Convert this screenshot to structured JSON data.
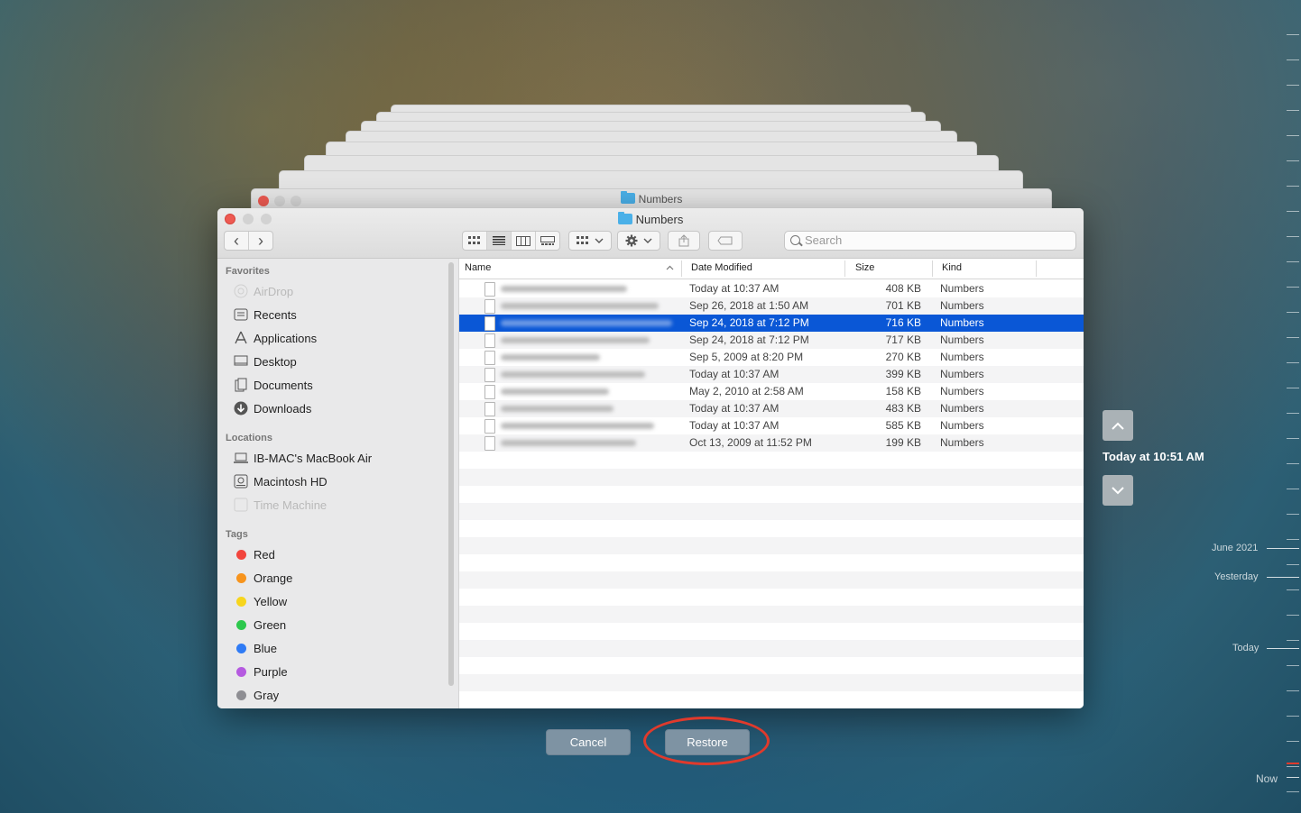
{
  "back_window": {
    "title": "Numbers"
  },
  "window": {
    "title": "Numbers"
  },
  "toolbar": {
    "back_glyph": "‹",
    "forward_glyph": "›",
    "view_icons": [
      "icon-view-icon",
      "list-view-icon",
      "column-view-icon",
      "gallery-view-icon"
    ],
    "search_placeholder": "Search"
  },
  "sidebar": {
    "favorites_header": "Favorites",
    "favorites": [
      {
        "label": "AirDrop",
        "icon": "airdrop-icon",
        "dim": true
      },
      {
        "label": "Recents",
        "icon": "recents-icon",
        "dim": false
      },
      {
        "label": "Applications",
        "icon": "applications-icon",
        "dim": false
      },
      {
        "label": "Desktop",
        "icon": "desktop-icon",
        "dim": false
      },
      {
        "label": "Documents",
        "icon": "documents-icon",
        "dim": false
      },
      {
        "label": "Downloads",
        "icon": "downloads-icon",
        "dim": false
      }
    ],
    "locations_header": "Locations",
    "locations": [
      {
        "label": "IB-MAC's MacBook Air",
        "icon": "laptop-icon",
        "dim": false
      },
      {
        "label": "Macintosh HD",
        "icon": "disk-icon",
        "dim": false
      },
      {
        "label": "Time Machine",
        "icon": "time-machine-icon",
        "dim": true
      }
    ],
    "tags_header": "Tags",
    "tags": [
      {
        "label": "Red",
        "color": "#f2453d"
      },
      {
        "label": "Orange",
        "color": "#f7941d"
      },
      {
        "label": "Yellow",
        "color": "#f7d51d"
      },
      {
        "label": "Green",
        "color": "#2dc84d"
      },
      {
        "label": "Blue",
        "color": "#2f7bf5"
      },
      {
        "label": "Purple",
        "color": "#b55ae0"
      },
      {
        "label": "Gray",
        "color": "#8e8e93"
      }
    ]
  },
  "columns": {
    "name": "Name",
    "date": "Date Modified",
    "size": "Size",
    "kind": "Kind"
  },
  "files": [
    {
      "date": "Today at 10:37 AM",
      "size": "408 KB",
      "kind": "Numbers",
      "selected": false
    },
    {
      "date": "Sep 26, 2018 at 1:50 AM",
      "size": "701 KB",
      "kind": "Numbers",
      "selected": false
    },
    {
      "date": "Sep 24, 2018 at 7:12 PM",
      "size": "716 KB",
      "kind": "Numbers",
      "selected": true
    },
    {
      "date": "Sep 24, 2018 at 7:12 PM",
      "size": "717 KB",
      "kind": "Numbers",
      "selected": false
    },
    {
      "date": "Sep 5, 2009 at 8:20 PM",
      "size": "270 KB",
      "kind": "Numbers",
      "selected": false
    },
    {
      "date": "Today at 10:37 AM",
      "size": "399 KB",
      "kind": "Numbers",
      "selected": false
    },
    {
      "date": "May 2, 2010 at 2:58 AM",
      "size": "158 KB",
      "kind": "Numbers",
      "selected": false
    },
    {
      "date": "Today at 10:37 AM",
      "size": "483 KB",
      "kind": "Numbers",
      "selected": false
    },
    {
      "date": "Today at 10:37 AM",
      "size": "585 KB",
      "kind": "Numbers",
      "selected": false
    },
    {
      "date": "Oct 13, 2009 at 11:52 PM",
      "size": "199 KB",
      "kind": "Numbers",
      "selected": false
    }
  ],
  "buttons": {
    "cancel": "Cancel",
    "restore": "Restore"
  },
  "time_machine": {
    "current": "Today at 10:51 AM",
    "labels": {
      "june": "June 2021",
      "yesterday": "Yesterday",
      "today": "Today",
      "now": "Now"
    }
  },
  "colors": {
    "selection": "#0a57d6",
    "highlight_ring": "#e03a2c",
    "button": "#7e93a3"
  }
}
